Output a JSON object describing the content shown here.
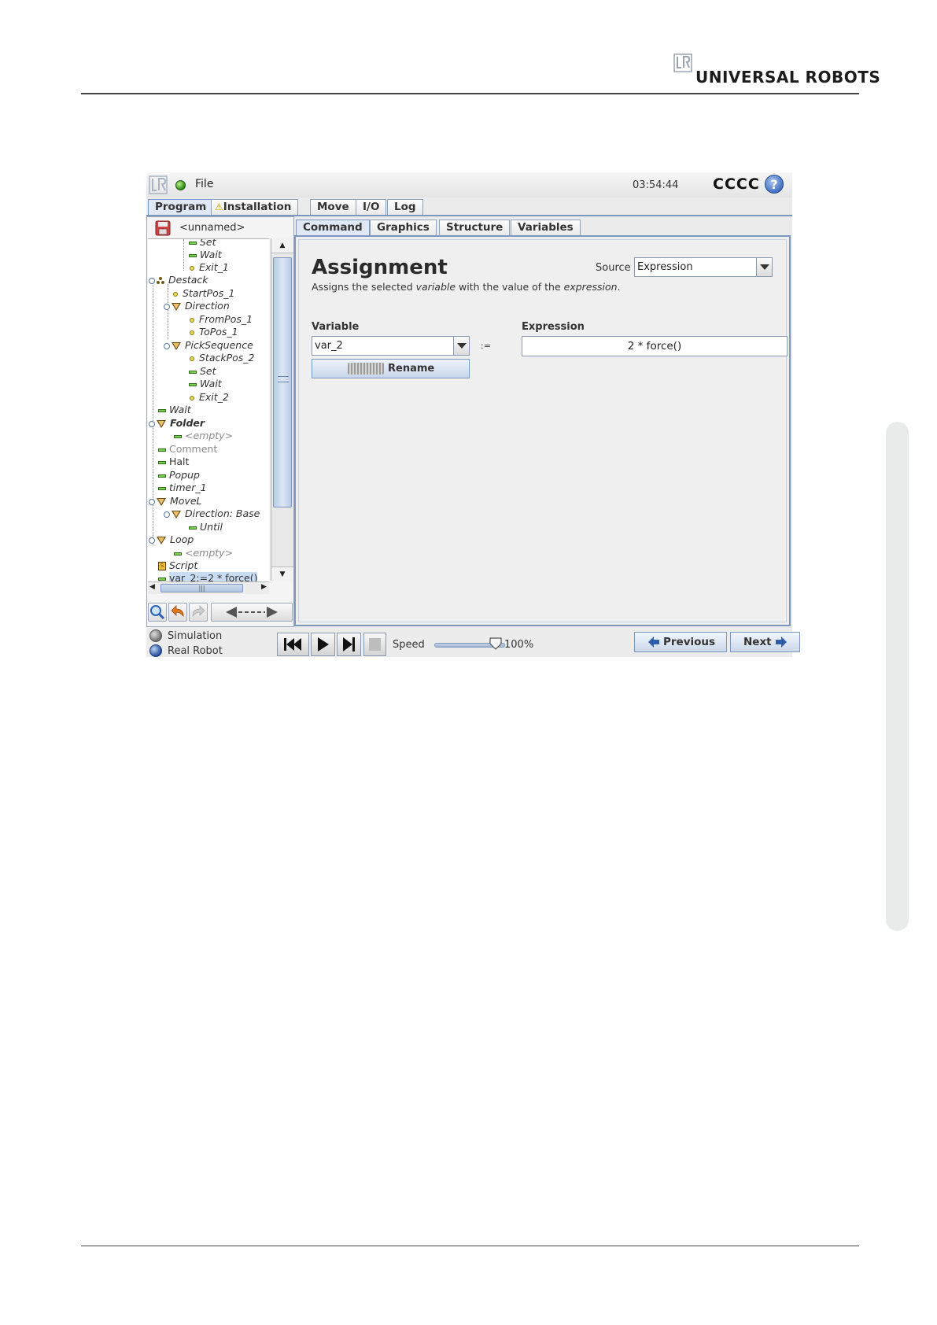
{
  "brand": {
    "name": "UNIVERSAL ROBOTS"
  },
  "app": {
    "menu": "File",
    "clock": "03:54:44",
    "robot_name": "CCCC",
    "help": "?",
    "main_tabs": [
      "Program",
      "Installation",
      "Move",
      "I/O",
      "Log"
    ],
    "program_name": "<unnamed>",
    "sub_tabs": [
      "Command",
      "Graphics",
      "Structure",
      "Variables"
    ]
  },
  "tree": [
    {
      "label": "Set",
      "icon": "line-icon"
    },
    {
      "label": "Wait",
      "icon": "line-icon"
    },
    {
      "label": "Exit_1",
      "icon": "waypoint-icon"
    },
    {
      "label": "Destack",
      "icon": "stack-icon"
    },
    {
      "label": "StartPos_1",
      "icon": "waypoint-icon"
    },
    {
      "label": "Direction",
      "icon": "move-icon"
    },
    {
      "label": "FromPos_1",
      "icon": "waypoint-icon"
    },
    {
      "label": "ToPos_1",
      "icon": "waypoint-icon"
    },
    {
      "label": "PickSequence",
      "icon": "move-icon"
    },
    {
      "label": "StackPos_2",
      "icon": "waypoint-icon"
    },
    {
      "label": "Set",
      "icon": "line-icon"
    },
    {
      "label": "Wait",
      "icon": "line-icon"
    },
    {
      "label": "Exit_2",
      "icon": "waypoint-icon"
    },
    {
      "label": "Wait",
      "icon": "line-icon"
    },
    {
      "label": "Folder",
      "icon": "folder-icon"
    },
    {
      "label": "<empty>",
      "icon": "line-icon"
    },
    {
      "label": "Comment",
      "icon": "line-icon"
    },
    {
      "label": "Halt",
      "icon": "line-icon"
    },
    {
      "label": "Popup",
      "icon": "line-icon"
    },
    {
      "label": "timer_1",
      "icon": "line-icon"
    },
    {
      "label": "MoveL",
      "icon": "move-icon"
    },
    {
      "label": "Direction: Base",
      "icon": "move-icon"
    },
    {
      "label": "Until",
      "icon": "line-icon"
    },
    {
      "label": "Loop",
      "icon": "loop-icon"
    },
    {
      "label": "<empty>",
      "icon": "line-icon"
    },
    {
      "label": "Script",
      "icon": "script-icon"
    },
    {
      "label": "var_2:=2 * force()",
      "icon": "line-icon"
    }
  ],
  "command": {
    "title": "Assignment",
    "desc_1": "Assigns the selected ",
    "desc_var": "variable",
    "desc_2": " with the value of the ",
    "desc_expr": "expression",
    "desc_3": ".",
    "source_label": "Source",
    "source_value": "Expression",
    "variable_label": "Variable",
    "variable_value": "var_2",
    "assign_op": ":=",
    "rename_label": "Rename",
    "expression_label": "Expression",
    "expression_value": "2 * force()"
  },
  "bottom": {
    "simulation": "Simulation",
    "real_robot": "Real Robot",
    "speed_label": "Speed",
    "speed_value": "100%",
    "speed_fraction": 1.0,
    "previous": "Previous",
    "next": "Next"
  },
  "colors": {
    "accent": "#7b97bd",
    "status": "#2f8a16"
  }
}
